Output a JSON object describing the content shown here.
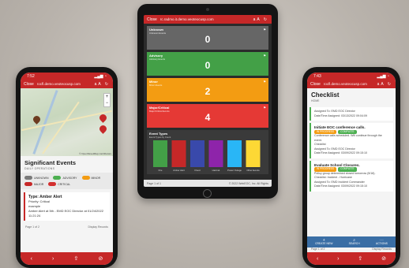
{
  "colors": {
    "brand_red": "#c62828",
    "unknown": "#7a7a7a",
    "advisory": "#4caf50",
    "minor": "#f39c12",
    "major": "#c62828",
    "critical": "#d32f2f",
    "toolbar_blue": "#3a6ea5"
  },
  "left_phone": {
    "status_time": "7:52",
    "close_label": "Close",
    "url": "rocfl.demo.veoteocusp.com",
    "url_icons": "aA ↻",
    "section_title": "Significant Events",
    "section_sub": "DAILY OPERATIONS",
    "map_credit": "© OpenStreetMap contributors",
    "legend": [
      {
        "label": "UNKNOWN",
        "color": "#7a7a7a"
      },
      {
        "label": "ADVISORY",
        "color": "#4caf50"
      },
      {
        "label": "MINOR",
        "color": "#f39c12"
      },
      {
        "label": "MAJOR",
        "color": "#c62828"
      },
      {
        "label": "CRITICAL",
        "color": "#d32f2f"
      }
    ],
    "card": {
      "title": "Type: Amber Alert",
      "priority": "Priority: Critical",
      "line1": "example",
      "line2": "Amber Alert at 5th - EMD EOC Director at 01/24/2022",
      "line3": "11:21:24"
    },
    "pager_left": "Page 1 of 2",
    "pager_right": "Display Records"
  },
  "tablet": {
    "close_label": "Close",
    "url": "rc.radmo.it.demo.veoteocusp.com",
    "tiles": [
      {
        "label": "Unknown",
        "sub": "Unknown Events",
        "value": "0",
        "color": "#666666"
      },
      {
        "label": "Advisory",
        "sub": "Advisory Events",
        "value": "0",
        "color": "#43a047"
      },
      {
        "label": "Minor",
        "sub": "Minor Events",
        "value": "2",
        "color": "#f39c12"
      },
      {
        "label": "Major/Critical",
        "sub": "Major/Critical Events",
        "value": "4",
        "color": "#e53935"
      }
    ],
    "event_types": {
      "label": "Event Types",
      "sub": "Event Types by Count",
      "categories": [
        "Fire",
        "Amber Alert",
        "Flood",
        "Hazmat",
        "Power Outage",
        "Other Events"
      ],
      "colors": [
        "#43a047",
        "#c62828",
        "#3949ab",
        "#8e24aa",
        "#29b6f6",
        "#fdd835"
      ]
    },
    "footer_left": "Page 1 of 1",
    "footer_right": "© 2022 WebEOC, Inc. All Rights"
  },
  "right_phone": {
    "status_time": "7:43",
    "close_label": "Close",
    "url": "rocfl.demo.veoteocusp.com",
    "url_icons": "aA ↻",
    "title": "Checklist",
    "sub": "HOME",
    "cards": [
      {
        "title": "",
        "lines": [
          "Assigned To: EMD EOC Director",
          "Date/Time Assigned: 03/13/2022 09:04:09"
        ],
        "pills": [],
        "border": "#4caf50"
      },
      {
        "title": "Initiate EOC conference calls.",
        "lines": [
          "Conference calls scheduled. Will continue through the event.",
          "Checklist",
          "Assigned To: EMD EOC Director",
          "Date/Time Assigned: 03/09/2022 09:15:10"
        ],
        "pills": [
          {
            "label": "IN PROGRESS",
            "color": "#f39c12"
          },
          {
            "label": "COMPLETE",
            "color": "#4caf50"
          }
        ],
        "border": "#4caf50"
      },
      {
        "title": "Evaluate School Closures.",
        "lines": [
          "Policy group determined closed tomorrow (5/18).",
          "Checklist: Incident - Hurricane",
          "Assigned To: EMD Incident Commander",
          "Date/Time Assigned: 03/09/2022 09:15:10"
        ],
        "pills": [
          {
            "label": "IN PROGRESS",
            "color": "#f39c12"
          },
          {
            "label": "COMPLETE",
            "color": "#4caf50"
          }
        ],
        "border": "#4caf50"
      }
    ],
    "toolbar": [
      {
        "icon": "+",
        "label": "CREATE NEW"
      },
      {
        "icon": "⌕",
        "label": "SEARCH"
      },
      {
        "icon": "⋯",
        "label": "ACTIONS"
      }
    ],
    "pager_left": "Page 1 of 2",
    "pager_right": "Display Records"
  }
}
